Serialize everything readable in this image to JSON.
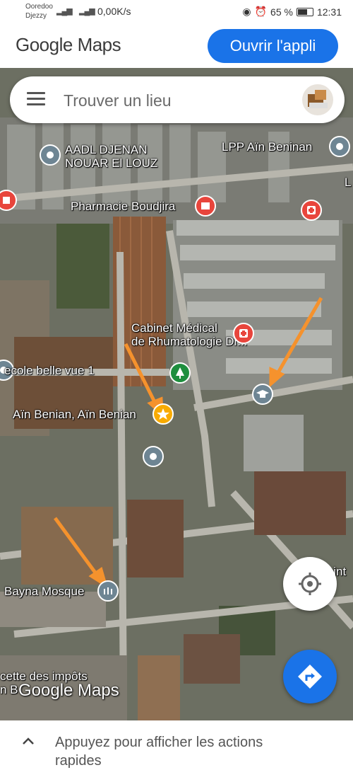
{
  "status_bar": {
    "carrier1": "Ooredoo",
    "carrier2": "Djezzy",
    "speed": "0,00K/s",
    "battery": "65 %",
    "time": "12:31"
  },
  "header": {
    "logo": "Google Maps",
    "open_app_label": "Ouvrir l'appli"
  },
  "search": {
    "placeholder": "Trouver un lieu"
  },
  "map_labels": {
    "aadl": "AADL DJENAN\nNOUAR El LOUZ",
    "lpp": "LPP Aïn Beninan",
    "pharmacie": "Pharmacie Boudjira",
    "cabinet": "Cabinet Médical\nde Rhumatologie Dr...",
    "ecole": "ecole belle vue 1",
    "ain_benian": "Aïn Benian, Aïn Benian",
    "mosque": "Bayna Mosque",
    "recette": "cette des impôts\nn B",
    "valpaint": "Valpaint",
    "edge_l": "L"
  },
  "map_watermark": "Google Maps",
  "bottom_panel": {
    "text": "Appuyez pour afficher les actions rapides"
  },
  "colors": {
    "brand_blue": "#1a73e8",
    "pin_gray": "#6e8593",
    "pin_red": "#e8453c",
    "pin_green": "#1e8e3e",
    "pin_yellow": "#f9ab00",
    "annotation_orange": "#f5922d"
  },
  "icons": {
    "menu": "hamburger-menu-icon",
    "avatar": "user-avatar",
    "locate": "my-location-icon",
    "directions": "directions-icon",
    "chevron": "chevron-up-icon"
  }
}
